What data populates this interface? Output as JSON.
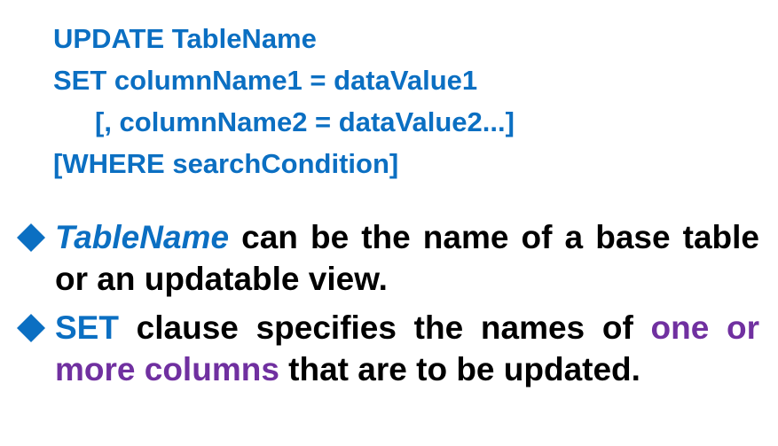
{
  "code_block": {
    "line1": "UPDATE TableName",
    "line2": "SET columnName1 = dataValue1",
    "line3": "[, columnName2 = dataValue2...]",
    "line4": "[WHERE searchCondition]"
  },
  "bullets": [
    {
      "icon": "diamond-icon",
      "term": "TableName",
      "text": " can be the name of a base table or an updatable view."
    },
    {
      "icon": "diamond-icon",
      "term": "SET",
      "text_before": " clause specifies the names of ",
      "highlight": "one or more columns",
      "text_after": " that are to be updated."
    }
  ],
  "colors": {
    "code": "#0b6fc2",
    "term": "#0b6fc2",
    "highlight": "#7030a0",
    "bullet_icon": "#0b6fc2",
    "body_text": "#000000"
  }
}
